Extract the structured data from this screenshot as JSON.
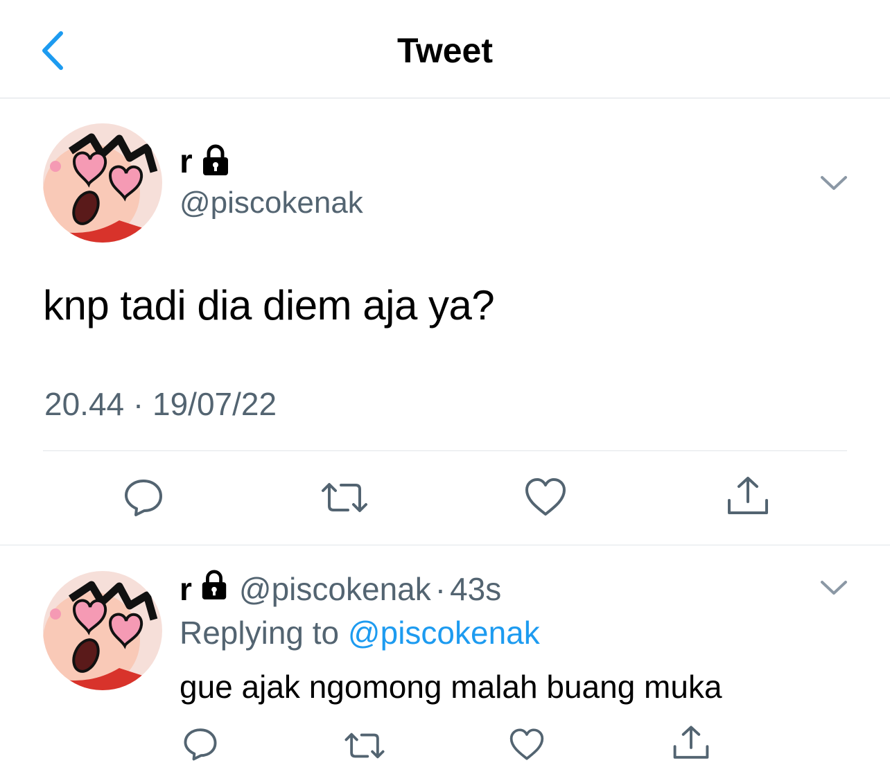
{
  "header": {
    "title": "Tweet",
    "back_icon": "chevron-left-icon"
  },
  "colors": {
    "accent": "#1d9bf0",
    "secondary_text": "#536471",
    "divider": "#e1e5e9"
  },
  "main_tweet": {
    "display_name": "r",
    "protected_icon": "lock-icon",
    "handle": "@piscokenak",
    "text": "knp tadi dia diem aja ya?",
    "timestamp": "20.44 · 19/07/22",
    "actions": [
      "reply-icon",
      "retweet-icon",
      "like-icon",
      "share-icon"
    ]
  },
  "reply_tweet": {
    "display_name": "r",
    "protected_icon": "lock-icon",
    "handle": "@piscokenak",
    "separator": "·",
    "time": "43s",
    "replying_prefix": "Replying to",
    "replying_to": "@piscokenak",
    "text": "gue ajak ngomong malah buang muka",
    "actions": [
      "reply-icon",
      "retweet-icon",
      "like-icon",
      "share-icon"
    ]
  }
}
